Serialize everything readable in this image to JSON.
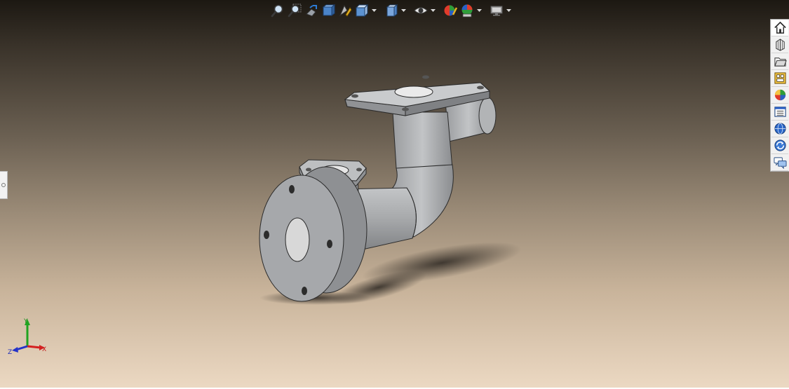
{
  "heads_up_toolbar": {
    "buttons": [
      {
        "icon": "zoom-to-fit-icon"
      },
      {
        "icon": "zoom-to-area-icon"
      },
      {
        "icon": "previous-view-icon"
      },
      {
        "icon": "section-view-icon"
      },
      {
        "icon": "dynamic-annotation-views-icon"
      },
      {
        "icon": "view-orientation-icon",
        "has_dropdown": true
      },
      {
        "icon": "display-style-icon",
        "has_dropdown": true
      },
      {
        "icon": "hide-show-items-icon",
        "has_dropdown": true
      },
      {
        "icon": "edit-appearance-icon"
      },
      {
        "icon": "apply-scene-icon",
        "has_dropdown": true
      },
      {
        "icon": "view-settings-icon",
        "has_dropdown": true
      }
    ]
  },
  "task_pane": {
    "tabs": [
      {
        "icon": "home-icon",
        "active": true
      },
      {
        "icon": "design-library-icon"
      },
      {
        "icon": "file-explorer-icon"
      },
      {
        "icon": "view-palette-icon"
      },
      {
        "icon": "appearances-scenes-icon"
      },
      {
        "icon": "custom-properties-icon"
      },
      {
        "icon": "solidworks-resources-icon"
      },
      {
        "icon": "forum-icon"
      },
      {
        "icon": "document-recovery-icon"
      }
    ]
  },
  "triad": {
    "x_label": "X",
    "y_label": "Y",
    "z_label": "Z",
    "x_color": "#d42020",
    "y_color": "#21a321",
    "z_color": "#2433c8"
  },
  "colors": {
    "background_top": "#1c1812",
    "background_bottom": "#ecd9c3",
    "part_gray": "#a9abad"
  }
}
